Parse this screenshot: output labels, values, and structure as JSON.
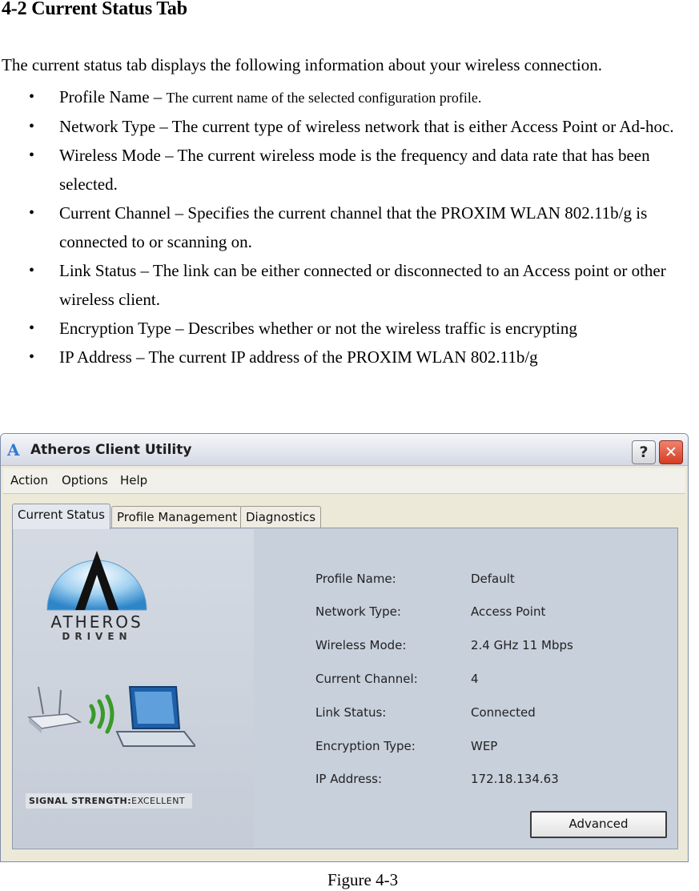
{
  "document": {
    "heading": "4-2 Current Status Tab",
    "intro": "The current status tab displays the following information about your wireless connection.",
    "bullets": [
      {
        "term": "Profile Name – ",
        "desc": "The current name of the selected configuration profile."
      },
      {
        "term": "Network Type – ",
        "desc": "The current type of wireless network that is either Access Point or Ad-hoc."
      },
      {
        "term": "Wireless Mode – ",
        "desc": "The current wireless mode is the frequency and data rate that has been selected."
      },
      {
        "term": "Current Channel – ",
        "desc": "Specifies the current channel that the PROXIM WLAN 802.11b/g is connected to or scanning on."
      },
      {
        "term": "Link Status – ",
        "desc": "The link can be either connected or disconnected to an Access point or other wireless client."
      },
      {
        "term": "Encryption Type – ",
        "desc": "Describes whether or not the wireless traffic is encrypting"
      },
      {
        "term": "IP Address – ",
        "desc": "The current IP address of the PROXIM WLAN 802.11b/g"
      }
    ],
    "bullet_glyph": "•",
    "caption": "Figure 4-3"
  },
  "dialog": {
    "title": "Atheros Client Utility",
    "title_logo": "A",
    "help_button": "?",
    "close_button": "✕",
    "menu": [
      "Action",
      "Options",
      "Help"
    ],
    "tabs": [
      "Current Status",
      "Profile Management",
      "Diagnostics"
    ],
    "active_tab": "Current Status",
    "logo_word": "ATHEROS",
    "logo_sub": "DRIVEN",
    "signal_label": "SIGNAL STRENGTH:",
    "signal_value": "EXCELLENT",
    "status": [
      {
        "label": "Profile Name:",
        "value": "Default"
      },
      {
        "label": "Network Type:",
        "value": "Access Point"
      },
      {
        "label": "Wireless Mode:",
        "value": "2.4 GHz 11 Mbps"
      },
      {
        "label": "Current Channel:",
        "value": "4"
      },
      {
        "label": "Link Status:",
        "value": "Connected"
      },
      {
        "label": "Encryption Type:",
        "value": "WEP"
      },
      {
        "label": "IP Address:",
        "value": "172.18.134.63"
      }
    ],
    "advanced_button": "Advanced"
  },
  "colors": {
    "title_logo": "#2d7ad8",
    "close_button": "#d43c22",
    "signal_waves": "#3a9a2a",
    "panel_bg": "#c8d0dc"
  }
}
